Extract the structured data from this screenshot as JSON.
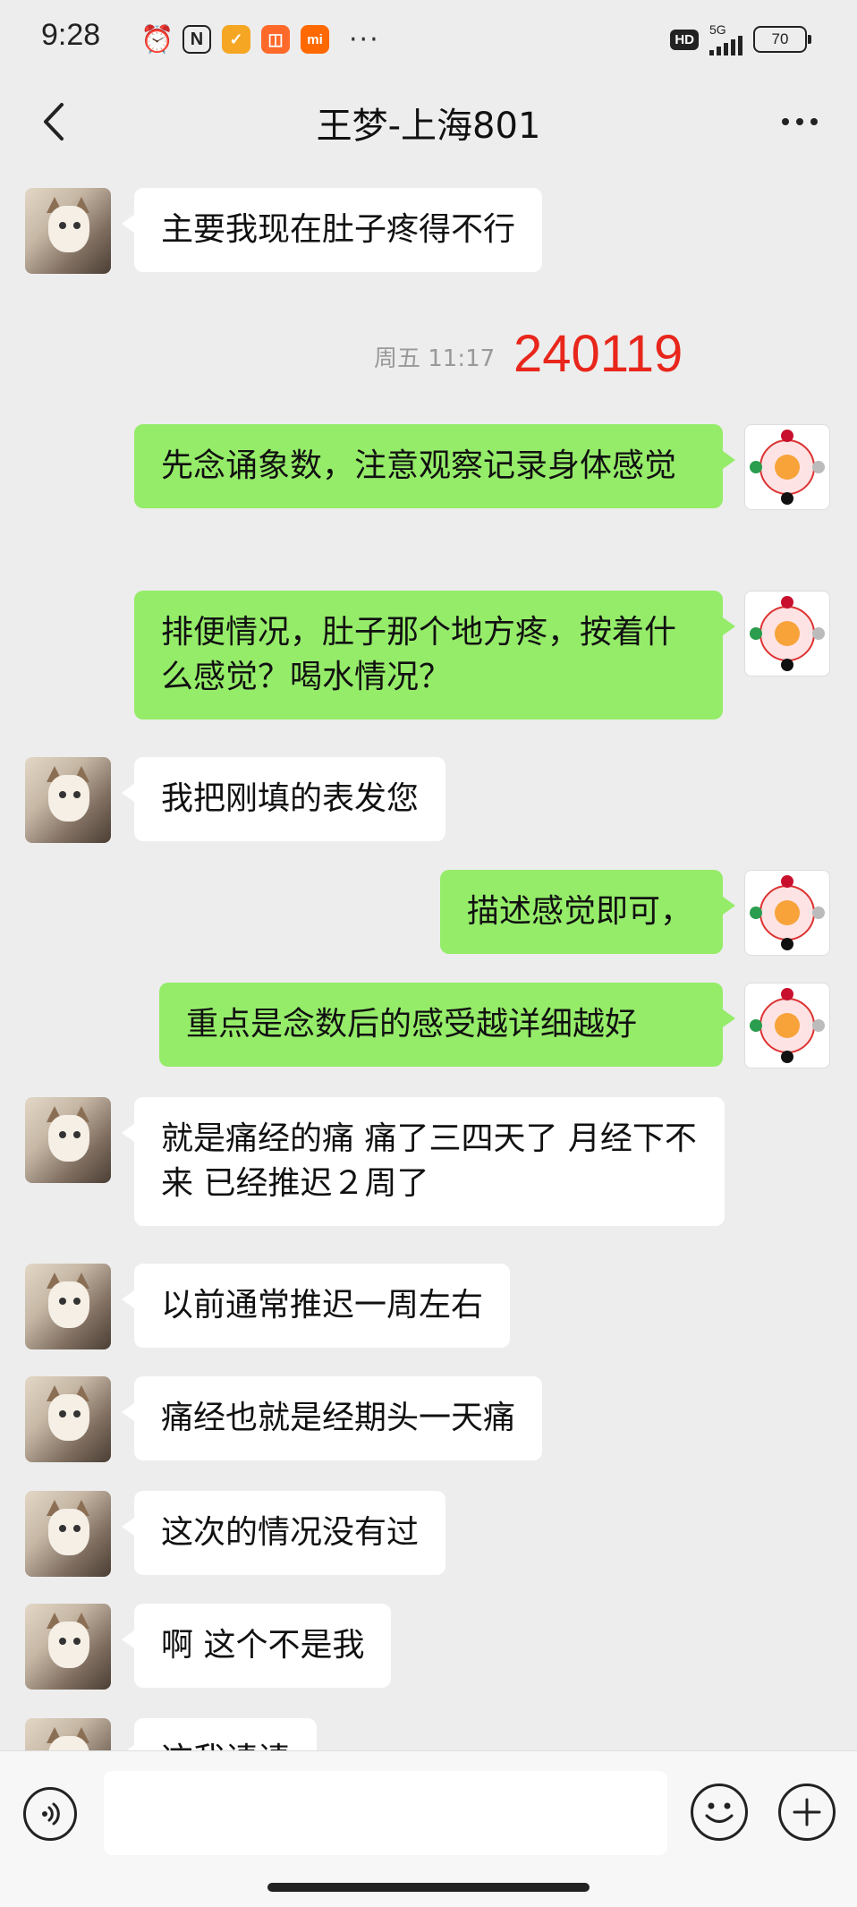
{
  "status_bar": {
    "time": "9:28",
    "app_icons": [
      {
        "name": "alarm-icon",
        "glyph": "⏰",
        "color": "#222222"
      },
      {
        "name": "nfc-icon",
        "glyph": "Ⓝ",
        "color": "#222222"
      },
      {
        "name": "orange-app-icon",
        "glyph": "✓",
        "color": "#f5a623"
      },
      {
        "name": "grid-app-icon",
        "glyph": "◫",
        "color": "#ff6a2b"
      },
      {
        "name": "mi-icon",
        "glyph": "mi",
        "color": "#ff6900"
      }
    ],
    "more": "···",
    "hd": "HD",
    "network": "5G",
    "battery": "70"
  },
  "header": {
    "title": "王梦-上海801"
  },
  "chat": {
    "timestamp": "周五 11:17",
    "overlay_number": "240119",
    "messages": [
      {
        "sender": "contact",
        "text": "主要我现在肚子疼得不行"
      },
      {
        "sender": "me",
        "text": "先念诵象数，注意观察记录身体感觉"
      },
      {
        "sender": "me",
        "text": "排便情况，肚子那个地方疼，按着什么感觉？喝水情况？"
      },
      {
        "sender": "contact",
        "text": "我把刚填的表发您"
      },
      {
        "sender": "me",
        "text": "描述感觉即可，"
      },
      {
        "sender": "me",
        "text": "重点是念数后的感受越详细越好"
      },
      {
        "sender": "contact",
        "text": "就是痛经的痛 痛了三四天了 月经下不来 已经推迟２周了"
      },
      {
        "sender": "contact",
        "text": "以前通常推迟一周左右"
      },
      {
        "sender": "contact",
        "text": "痛经也就是经期头一天痛"
      },
      {
        "sender": "contact",
        "text": "这次的情况没有过"
      },
      {
        "sender": "contact",
        "text": "啊 这个不是我"
      },
      {
        "sender": "contact",
        "text": "这我请请"
      }
    ]
  },
  "input_bar": {
    "value": ""
  },
  "colors": {
    "background": "#ededed",
    "incoming_bubble": "#ffffff",
    "outgoing_bubble": "#95ec69",
    "overlay_number": "#e8261b"
  }
}
